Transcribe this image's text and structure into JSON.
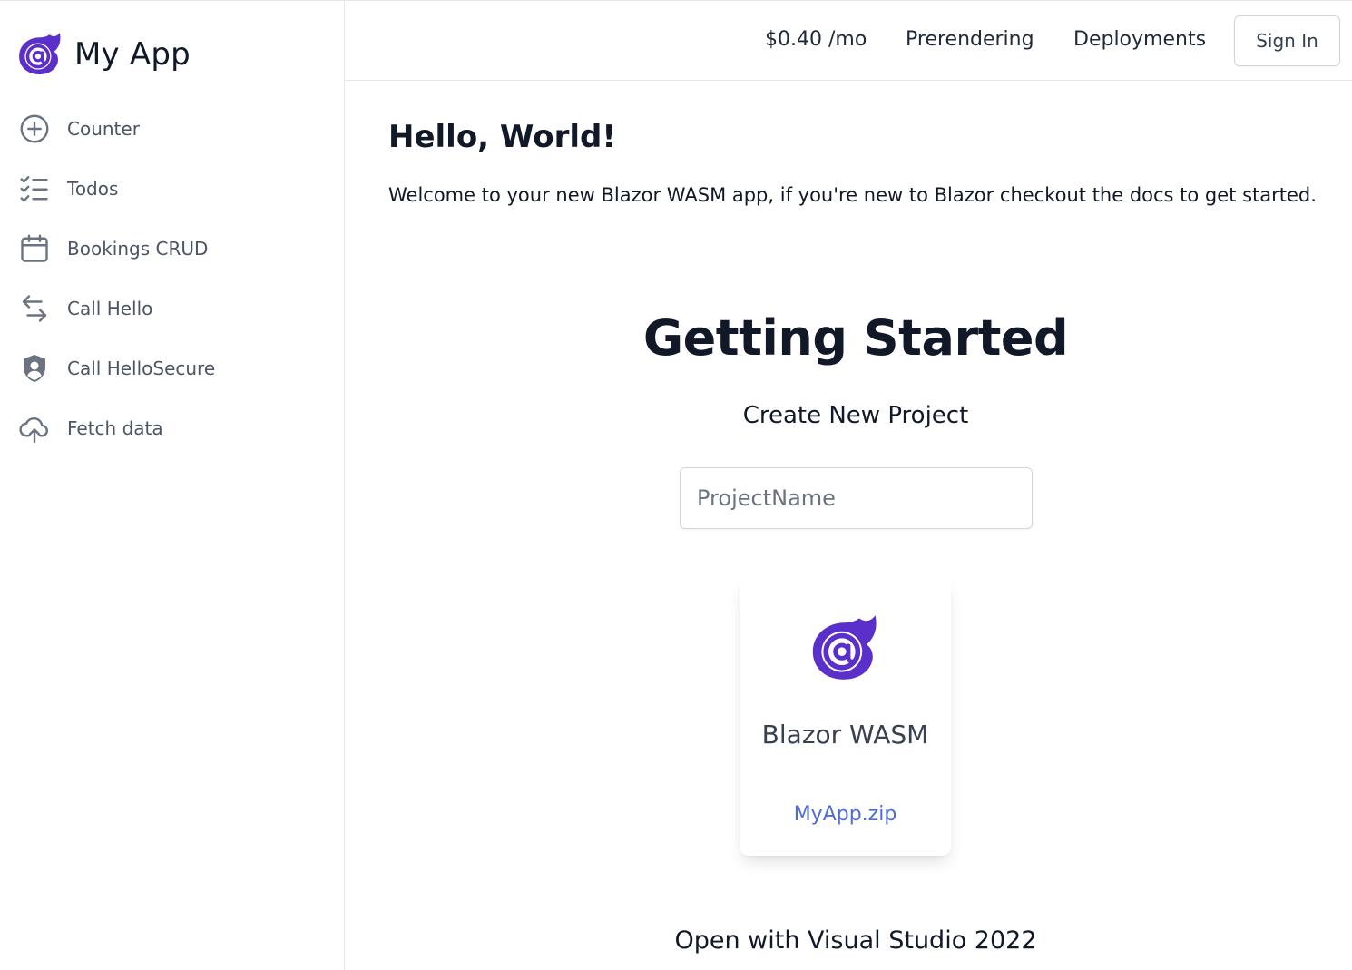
{
  "app": {
    "title": "My App",
    "brand_color": "#5b2fc9"
  },
  "sidebar": {
    "items": [
      {
        "label": "Counter",
        "icon": "plus-circle-icon"
      },
      {
        "label": "Todos",
        "icon": "checklist-icon"
      },
      {
        "label": "Bookings CRUD",
        "icon": "calendar-icon"
      },
      {
        "label": "Call Hello",
        "icon": "arrows-left-right-icon"
      },
      {
        "label": "Call HelloSecure",
        "icon": "shield-user-icon"
      },
      {
        "label": "Fetch data",
        "icon": "cloud-upload-icon"
      }
    ]
  },
  "header": {
    "links": [
      "$0.40 /mo",
      "Prerendering",
      "Deployments"
    ],
    "signin_label": "Sign In"
  },
  "main": {
    "heading": "Hello, World!",
    "welcome": "Welcome to your new Blazor WASM app, if you're new to Blazor checkout the docs to get started.",
    "getting_started": {
      "title": "Getting Started",
      "subtitle": "Create New Project",
      "input_placeholder": "ProjectName",
      "input_value": "",
      "template": {
        "name": "Blazor WASM",
        "download": "MyApp.zip",
        "icon": "blazor-logo-icon"
      },
      "open_with": "Open with Visual Studio 2022"
    }
  }
}
